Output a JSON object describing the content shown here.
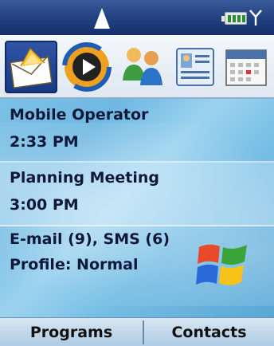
{
  "status_bar": {
    "signal_icon": "signal-triangle-icon",
    "battery_icon": "battery-icon",
    "antenna_icon": "antenna-icon"
  },
  "app_icons": [
    {
      "name": "messaging",
      "icon": "envelope-icon",
      "selected": true
    },
    {
      "name": "media-player",
      "icon": "media-player-icon",
      "selected": false
    },
    {
      "name": "contacts",
      "icon": "people-icon",
      "selected": false
    },
    {
      "name": "contact-card",
      "icon": "contact-card-icon",
      "selected": false
    },
    {
      "name": "calendar",
      "icon": "calendar-icon",
      "selected": false
    }
  ],
  "today": {
    "operator": "Mobile Operator",
    "time": "2:33 PM",
    "appointment": "Planning Meeting",
    "appointment_time": "3:00 PM",
    "messages": "E-mail (9), SMS (6)",
    "profile": "Profile: Normal"
  },
  "softkeys": {
    "left": "Programs",
    "right": "Contacts"
  },
  "colors": {
    "status_bar": "#1f3d7c",
    "today_background": "#74bde4",
    "text": "#10183a"
  }
}
